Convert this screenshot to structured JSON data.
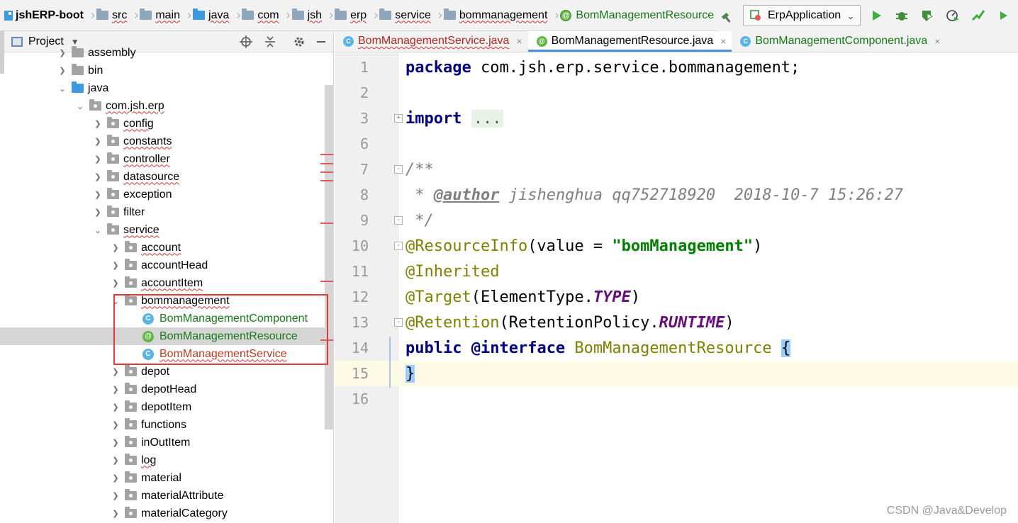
{
  "breadcrumbs": [
    {
      "label": "jshERP-boot",
      "icon": "project-icon"
    },
    {
      "label": "src",
      "icon": "folder-icon"
    },
    {
      "label": "main",
      "icon": "folder-icon"
    },
    {
      "label": "java",
      "icon": "folder-blue-icon"
    },
    {
      "label": "com",
      "icon": "folder-icon"
    },
    {
      "label": "jsh",
      "icon": "folder-icon"
    },
    {
      "label": "erp",
      "icon": "folder-icon"
    },
    {
      "label": "service",
      "icon": "folder-icon"
    },
    {
      "label": "bommanagement",
      "icon": "folder-icon"
    },
    {
      "label": "BomManagementResource",
      "icon": "annotation-icon"
    }
  ],
  "run_config": {
    "label": "ErpApplication"
  },
  "toolbar_icons": [
    "hammer-icon",
    "run-icon",
    "debug-icon",
    "coverage-icon",
    "profile-icon",
    "build-icon"
  ],
  "project_panel": {
    "title": "Project"
  },
  "tree": [
    {
      "label": "assembly",
      "level": 3,
      "arrow": "right",
      "icon": "folder",
      "err": false
    },
    {
      "label": "bin",
      "level": 3,
      "arrow": "right",
      "icon": "folder",
      "err": false
    },
    {
      "label": "java",
      "level": 3,
      "arrow": "down",
      "icon": "folder-blue",
      "err": false
    },
    {
      "label": "com.jsh.erp",
      "level": 4,
      "arrow": "down",
      "icon": "package",
      "err": true
    },
    {
      "label": "config",
      "level": 5,
      "arrow": "right",
      "icon": "package",
      "err": true
    },
    {
      "label": "constants",
      "level": 5,
      "arrow": "right",
      "icon": "package",
      "err": true
    },
    {
      "label": "controller",
      "level": 5,
      "arrow": "right",
      "icon": "package",
      "err": true
    },
    {
      "label": "datasource",
      "level": 5,
      "arrow": "right",
      "icon": "package",
      "err": true
    },
    {
      "label": "exception",
      "level": 5,
      "arrow": "right",
      "icon": "package",
      "err": false
    },
    {
      "label": "filter",
      "level": 5,
      "arrow": "right",
      "icon": "package",
      "err": false
    },
    {
      "label": "service",
      "level": 5,
      "arrow": "down",
      "icon": "package",
      "err": true
    },
    {
      "label": "account",
      "level": 6,
      "arrow": "right",
      "icon": "package",
      "err": true
    },
    {
      "label": "accountHead",
      "level": 6,
      "arrow": "right",
      "icon": "package",
      "err": false
    },
    {
      "label": "accountItem",
      "level": 6,
      "arrow": "right",
      "icon": "package",
      "err": true
    },
    {
      "label": "bommanagement",
      "level": 6,
      "arrow": "down",
      "icon": "package",
      "err": true
    },
    {
      "label": "BomManagementComponent",
      "level": 7,
      "arrow": "",
      "icon": "class",
      "err": false,
      "color": "green"
    },
    {
      "label": "BomManagementResource",
      "level": 7,
      "arrow": "",
      "icon": "annotation",
      "err": false,
      "color": "green",
      "selected": true
    },
    {
      "label": "BomManagementService",
      "level": 7,
      "arrow": "",
      "icon": "class",
      "err": true,
      "color": "orange"
    },
    {
      "label": "depot",
      "level": 6,
      "arrow": "right",
      "icon": "package",
      "err": false
    },
    {
      "label": "depotHead",
      "level": 6,
      "arrow": "right",
      "icon": "package",
      "err": false
    },
    {
      "label": "depotItem",
      "level": 6,
      "arrow": "right",
      "icon": "package",
      "err": false
    },
    {
      "label": "functions",
      "level": 6,
      "arrow": "right",
      "icon": "package",
      "err": false
    },
    {
      "label": "inOutItem",
      "level": 6,
      "arrow": "right",
      "icon": "package",
      "err": false
    },
    {
      "label": "log",
      "level": 6,
      "arrow": "right",
      "icon": "package",
      "err": true
    },
    {
      "label": "material",
      "level": 6,
      "arrow": "right",
      "icon": "package",
      "err": false
    },
    {
      "label": "materialAttribute",
      "level": 6,
      "arrow": "right",
      "icon": "package",
      "err": false
    },
    {
      "label": "materialCategory",
      "level": 6,
      "arrow": "right",
      "icon": "package",
      "err": false
    }
  ],
  "tabs": [
    {
      "label": "BomManagementService.java",
      "icon": "class",
      "style": "red",
      "active": false
    },
    {
      "label": "BomManagementResource.java",
      "icon": "annotation",
      "style": "normal",
      "active": true
    },
    {
      "label": "BomManagementComponent.java",
      "icon": "class",
      "style": "green",
      "active": false
    }
  ],
  "code": {
    "line_numbers": [
      "1",
      "2",
      "3",
      "6",
      "7",
      "8",
      "9",
      "10",
      "11",
      "12",
      "13",
      "14",
      "15",
      "16"
    ],
    "pkg_kw": "package",
    "pkg_name": " com.jsh.erp.service.bommanagement;",
    "import_kw": "import",
    "import_fold": "...",
    "doc_open": "/**",
    "doc_star": " * ",
    "doc_tag": "@author",
    "doc_author": " jishenghua qq752718920  2018-10-7 15:26:27",
    "doc_close": " */",
    "ann_resource": "@ResourceInfo",
    "ann_resource_open": "(value = ",
    "ann_resource_value": "\"bomManagement\"",
    "ann_resource_close": ")",
    "ann_inherited": "@Inherited",
    "ann_target": "@Target",
    "ann_target_open": "(ElementType.",
    "ann_target_const": "TYPE",
    "ann_target_close": ")",
    "ann_retention": "@Retention",
    "ann_retention_open": "(RetentionPolicy.",
    "ann_retention_const": "RUNTIME",
    "ann_retention_close": ")",
    "decl_public": "public",
    "decl_interface": " @interface",
    "decl_name": " BomManagementResource ",
    "brace_open": "{",
    "brace_close": "}"
  },
  "watermark": "CSDN @Java&Develop",
  "colors": {
    "keyword": "#000080",
    "annotation": "#808000",
    "string": "#008000",
    "constant": "#660e7a",
    "highlight_box": "#e53935"
  }
}
